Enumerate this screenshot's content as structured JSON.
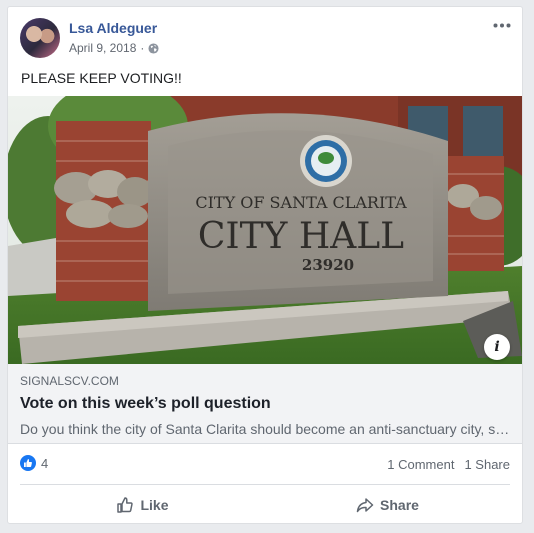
{
  "post": {
    "author": "Lsa Aldeguer",
    "date": "April 9, 2018",
    "separator": "·",
    "privacy_icon": "globe-icon",
    "text": "PLEASE KEEP VOTING!!"
  },
  "link": {
    "image_caption": "CITY OF SANTA CLARITA CITY HALL 23920",
    "sign_line1": "CITY OF SANTA CLARITA",
    "sign_line2": "CITY HALL",
    "sign_number": "23920",
    "info_label": "i",
    "domain": "SIGNALSCV.COM",
    "title": "Vote on this week’s poll question",
    "description": "Do you think the city of Santa Clarita should become an anti-sanctuary city, similar to other cities in Southern California?"
  },
  "engagement": {
    "like_count": "4",
    "comments": "1 Comment",
    "shares": "1 Share"
  },
  "actions": {
    "like_label": "Like",
    "share_label": "Share"
  },
  "colors": {
    "brand": "#385898",
    "like_blue": "#1877f2",
    "background": "#e9ebee"
  }
}
